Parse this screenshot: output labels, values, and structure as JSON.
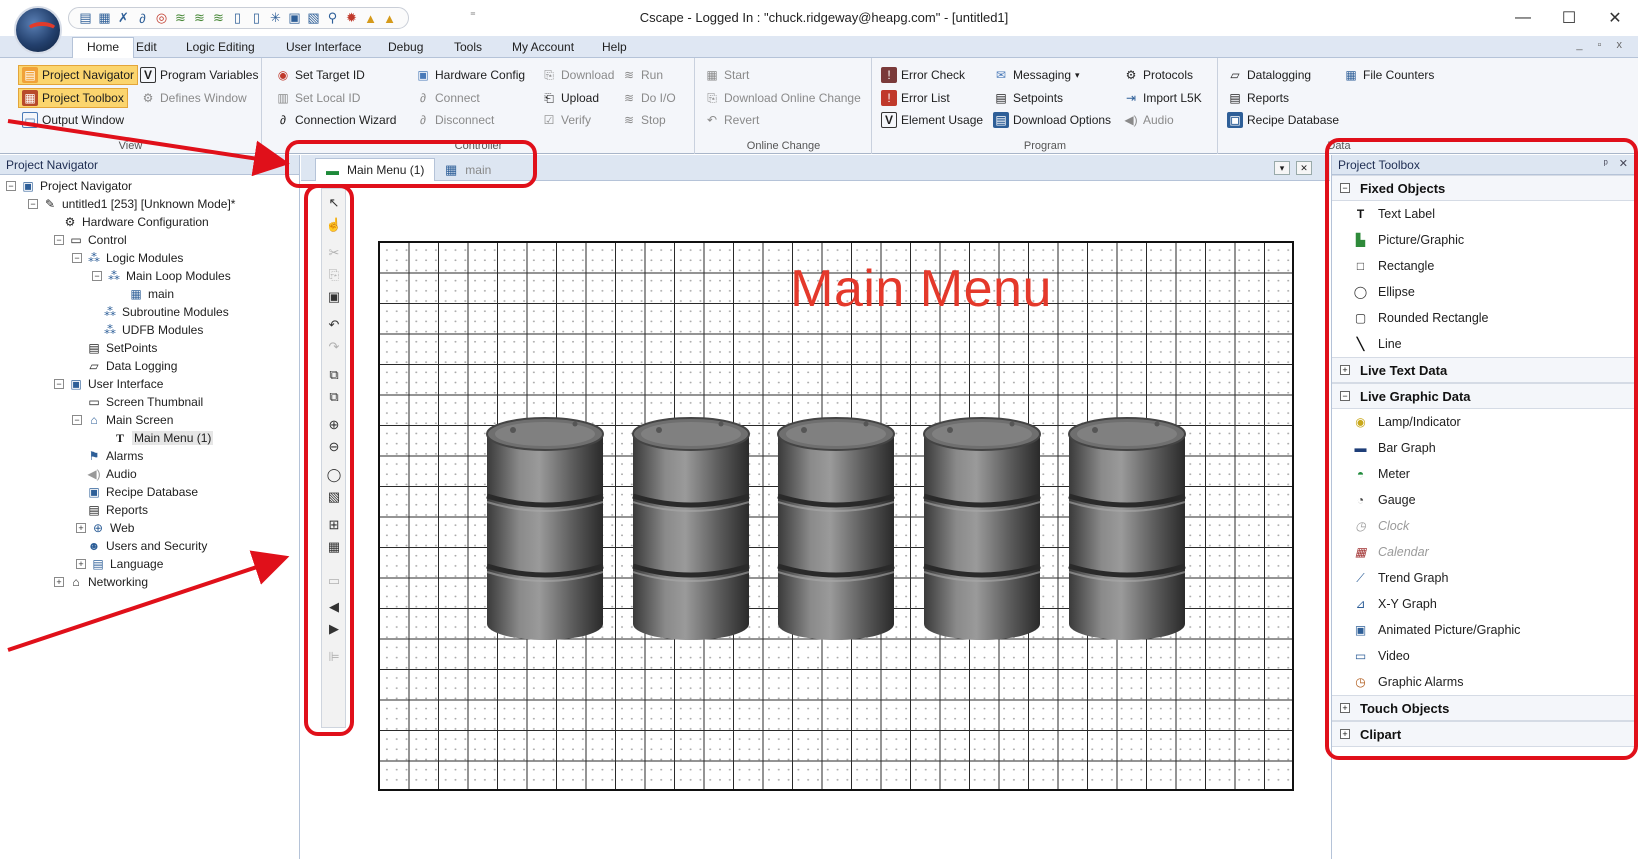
{
  "window": {
    "title": "Cscape - Logged In : \"chuck.ridgeway@heapg.com\" - [untitled1]",
    "controls": {
      "minimize": "—",
      "maximize": "☐",
      "close": "✕"
    },
    "mdi_controls": "_ ▫ x"
  },
  "quick_access": {
    "icons": [
      "save-icon",
      "config-icon",
      "tool-icon",
      "link-icon",
      "target-icon",
      "io-icon",
      "io2-icon",
      "io3-icon",
      "page-icon",
      "page2-icon",
      "star-icon",
      "screen-icon",
      "screen2-icon",
      "search-icon",
      "bug-icon",
      "lock-icon",
      "lock2-icon"
    ],
    "more": "⁼"
  },
  "menu": {
    "tabs": [
      "Home",
      "Edit",
      "Logic Editing",
      "User Interface",
      "Debug",
      "Tools",
      "My Account",
      "Help"
    ]
  },
  "ribbon": {
    "view": {
      "label": "View",
      "project_navigator": "Project Navigator",
      "program_variables": "Program Variables",
      "project_toolbox": "Project Toolbox",
      "defines_window": "Defines Window",
      "output_window": "Output Window"
    },
    "controller": {
      "label": "Controller",
      "set_target_id": "Set Target  ID",
      "set_local_id": "Set Local  ID",
      "connection_wizard": "Connection Wizard",
      "hardware_config": "Hardware Config",
      "connect": "Connect",
      "disconnect": "Disconnect",
      "download": "Download",
      "upload": "Upload",
      "verify": "Verify",
      "run": "Run",
      "do_io": "Do I/O",
      "stop": "Stop"
    },
    "online_change": {
      "label": "Online Change",
      "start": "Start",
      "download_online_change": "Download Online Change",
      "revert": "Revert"
    },
    "program": {
      "label": "Program",
      "error_check": "Error Check",
      "error_list": "Error List",
      "element_usage": "Element Usage",
      "messaging": "Messaging",
      "setpoints": "Setpoints",
      "download_options": "Download Options",
      "protocols": "Protocols",
      "import_l5k": "Import  L5K",
      "audio": "Audio"
    },
    "data": {
      "label": "Data",
      "datalogging": "Datalogging",
      "file_counters": "File Counters",
      "reports": "Reports",
      "recipe_database": "Recipe Database"
    }
  },
  "project_navigator": {
    "title": "Project Navigator",
    "panel_controls": "ᵖ ✕",
    "tree": [
      {
        "label": "Project Navigator"
      },
      {
        "label": "untitled1 [253] [Unknown Mode]*"
      },
      {
        "label": "Hardware Configuration"
      },
      {
        "label": "Control"
      },
      {
        "label": "Logic Modules"
      },
      {
        "label": "Main Loop Modules"
      },
      {
        "label": "main"
      },
      {
        "label": "Subroutine Modules"
      },
      {
        "label": "UDFB Modules"
      },
      {
        "label": "SetPoints"
      },
      {
        "label": "Data Logging"
      },
      {
        "label": "User Interface"
      },
      {
        "label": "Screen Thumbnail"
      },
      {
        "label": "Main Screen"
      },
      {
        "label": "Main Menu (1)"
      },
      {
        "label": "Alarms"
      },
      {
        "label": "Audio"
      },
      {
        "label": "Recipe Database"
      },
      {
        "label": "Reports"
      },
      {
        "label": "Web"
      },
      {
        "label": "Users and Security"
      },
      {
        "label": "Language"
      },
      {
        "label": "Networking"
      }
    ]
  },
  "documents": {
    "tabs": [
      {
        "label": "Main Menu (1)",
        "active": true
      },
      {
        "label": "main",
        "active": false
      }
    ],
    "tab_controls": [
      "▾",
      "✕"
    ]
  },
  "screen": {
    "title": "Main Menu",
    "title_color": "#e4392b",
    "barrel_count": 5
  },
  "toolbox": {
    "title": "Project Toolbox",
    "panel_controls": "ᵖ ✕",
    "sections": [
      {
        "label": "Fixed Objects",
        "expanded": true,
        "items": [
          {
            "label": "Text Label",
            "icon": "text-icon"
          },
          {
            "label": "Picture/Graphic",
            "icon": "picture-icon"
          },
          {
            "label": "Rectangle",
            "icon": "rectangle-icon"
          },
          {
            "label": "Ellipse",
            "icon": "ellipse-icon"
          },
          {
            "label": "Rounded Rectangle",
            "icon": "rounded-rectangle-icon"
          },
          {
            "label": "Line",
            "icon": "line-icon"
          }
        ]
      },
      {
        "label": "Live Text Data",
        "expanded": false,
        "items": []
      },
      {
        "label": "Live Graphic Data",
        "expanded": true,
        "items": [
          {
            "label": "Lamp/Indicator",
            "icon": "lamp-icon"
          },
          {
            "label": "Bar Graph",
            "icon": "bar-graph-icon"
          },
          {
            "label": "Meter",
            "icon": "meter-icon"
          },
          {
            "label": "Gauge",
            "icon": "gauge-icon"
          },
          {
            "label": "Clock",
            "icon": "clock-icon",
            "disabled": true
          },
          {
            "label": "Calendar",
            "icon": "calendar-icon",
            "disabled": true
          },
          {
            "label": "Trend Graph",
            "icon": "trend-graph-icon"
          },
          {
            "label": "X-Y Graph",
            "icon": "xy-graph-icon"
          },
          {
            "label": "Animated Picture/Graphic",
            "icon": "animated-picture-icon"
          },
          {
            "label": "Video",
            "icon": "video-icon"
          },
          {
            "label": "Graphic Alarms",
            "icon": "graphic-alarms-icon"
          }
        ]
      },
      {
        "label": "Touch Objects",
        "expanded": false,
        "items": []
      },
      {
        "label": "Clipart",
        "expanded": false,
        "items": []
      }
    ]
  },
  "annotation_color": "#e0101a"
}
